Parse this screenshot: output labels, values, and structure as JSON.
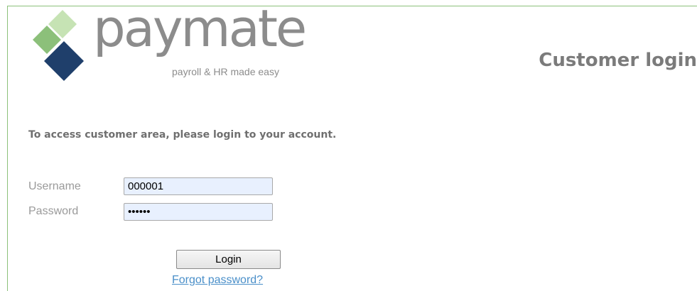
{
  "brand": {
    "logo_text": "paymate",
    "tagline": "payroll & HR made easy",
    "colors": {
      "light_green": "#c6e3b4",
      "green": "#8cc07a",
      "navy": "#1f3f6b",
      "gray": "#8c8c8c"
    }
  },
  "header": {
    "title": "Customer login"
  },
  "form": {
    "intro": "To access customer area, please login to your account.",
    "username": {
      "label": "Username",
      "value": "000001"
    },
    "password": {
      "label": "Password",
      "value": "••••••"
    },
    "login_label": "Login",
    "forgot_label": "Forgot password?"
  }
}
